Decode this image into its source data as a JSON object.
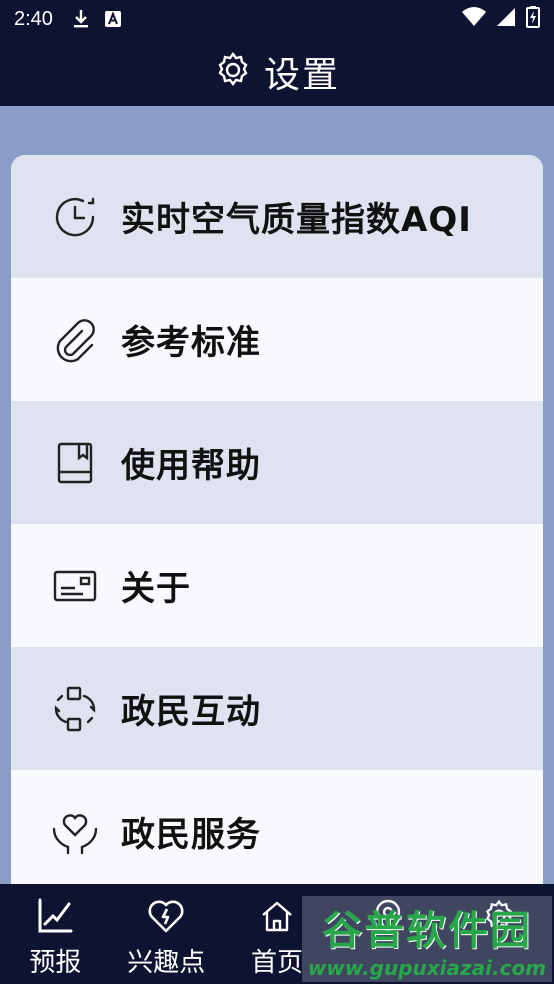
{
  "status_bar": {
    "time": "2:40",
    "icons": [
      "download-icon",
      "a-letter-icon",
      "wifi-icon",
      "signal-icon",
      "battery-icon"
    ]
  },
  "header": {
    "title": "设置",
    "icon": "gear-icon"
  },
  "menu": {
    "items": [
      {
        "label": "实时空气质量指数AQI",
        "icon": "clock-icon"
      },
      {
        "label": "参考标准",
        "icon": "paperclip-icon"
      },
      {
        "label": "使用帮助",
        "icon": "book-icon"
      },
      {
        "label": "关于",
        "icon": "card-icon"
      },
      {
        "label": "政民互动",
        "icon": "exchange-icon"
      },
      {
        "label": "政民服务",
        "icon": "heart-hand-icon"
      }
    ]
  },
  "bottom_nav": {
    "items": [
      {
        "label": "预报",
        "icon": "chart-icon"
      },
      {
        "label": "兴趣点",
        "icon": "heart-icon"
      },
      {
        "label": "首页",
        "icon": "home-icon"
      },
      {
        "label": "",
        "icon": "map-icon"
      },
      {
        "label": "",
        "icon": "gear-icon"
      }
    ]
  },
  "watermark": {
    "main": "谷普软件园",
    "sub": "www.gupuxiazai.com"
  },
  "colors": {
    "dark_navy": "#0D1330",
    "background": "#8A9DC6",
    "row_shade": "#DFE3EF",
    "row_light": "#F8F9FD"
  }
}
